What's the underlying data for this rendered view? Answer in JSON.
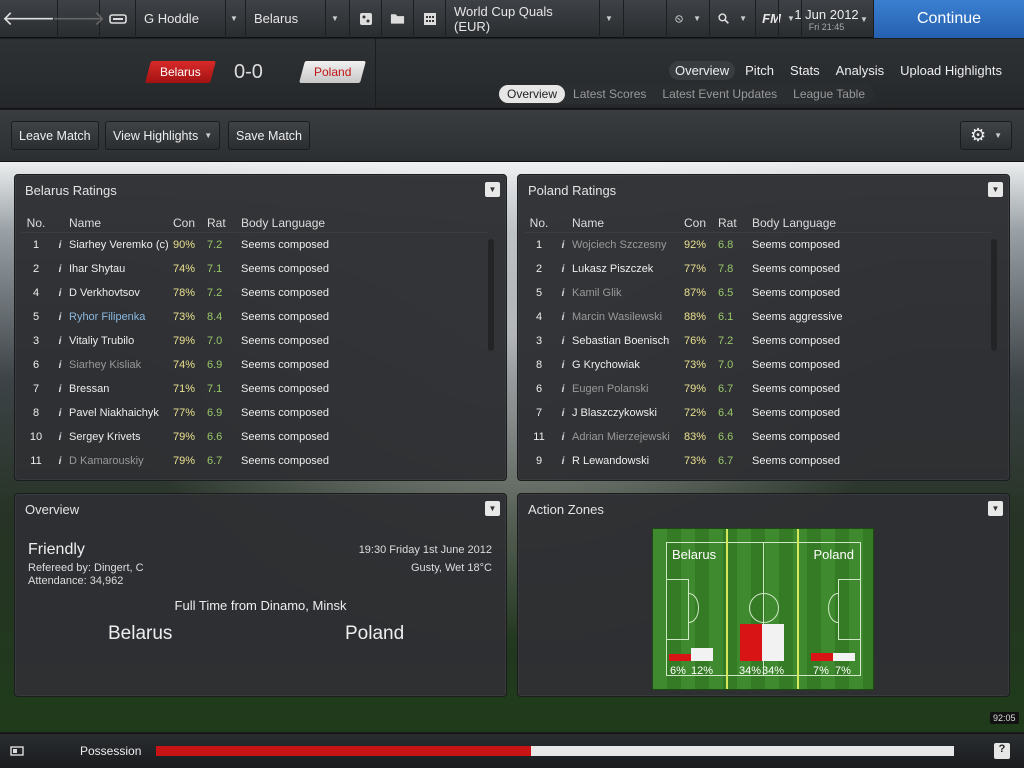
{
  "topbar": {
    "back": "🡐",
    "forward": "🡒",
    "manager": "G Hoddle",
    "team": "Belarus",
    "competition": "World Cup Quals (EUR)",
    "fm_logo": "FM",
    "date": "1 Jun 2012",
    "time": "Fri 21:45",
    "continue": "Continue"
  },
  "header": {
    "home": "Belarus",
    "away": "Poland",
    "score": "0-0",
    "tabs": [
      "Overview",
      "Pitch",
      "Stats",
      "Analysis",
      "Upload Highlights"
    ],
    "subtabs": [
      "Overview",
      "Latest Scores",
      "Latest Event Updates",
      "League Table"
    ]
  },
  "actions": {
    "leave": "Leave Match",
    "highlights": "View Highlights",
    "save": "Save Match"
  },
  "ratings_headers": {
    "no": "No.",
    "name": "Name",
    "con": "Con",
    "rat": "Rat",
    "body": "Body Language"
  },
  "belarus": {
    "title": "Belarus Ratings",
    "rows": [
      {
        "no": "1",
        "name": "Siarhey Veremko (c)",
        "con": "90%",
        "rat": "7.2",
        "body": "Seems composed",
        "style": ""
      },
      {
        "no": "2",
        "name": "Ihar Shytau",
        "con": "74%",
        "rat": "7.1",
        "body": "Seems composed",
        "style": ""
      },
      {
        "no": "4",
        "name": "D Verkhovtsov",
        "con": "78%",
        "rat": "7.2",
        "body": "Seems composed",
        "style": ""
      },
      {
        "no": "5",
        "name": "Ryhor Filipenka",
        "con": "73%",
        "rat": "8.4",
        "body": "Seems composed",
        "style": "blue"
      },
      {
        "no": "3",
        "name": "Vitaliy Trubilo",
        "con": "79%",
        "rat": "7.0",
        "body": "Seems composed",
        "style": ""
      },
      {
        "no": "6",
        "name": "Siarhey Kisliak",
        "con": "74%",
        "rat": "6.9",
        "body": "Seems composed",
        "style": "muted"
      },
      {
        "no": "7",
        "name": "Bressan",
        "con": "71%",
        "rat": "7.1",
        "body": "Seems composed",
        "style": ""
      },
      {
        "no": "8",
        "name": "Pavel Niakhaichyk",
        "con": "77%",
        "rat": "6.9",
        "body": "Seems composed",
        "style": ""
      },
      {
        "no": "10",
        "name": "Sergey Krivets",
        "con": "79%",
        "rat": "6.6",
        "body": "Seems composed",
        "style": ""
      },
      {
        "no": "11",
        "name": "D Kamarouskiy",
        "con": "79%",
        "rat": "6.7",
        "body": "Seems composed",
        "style": "muted"
      }
    ]
  },
  "poland": {
    "title": "Poland Ratings",
    "rows": [
      {
        "no": "1",
        "name": "Wojciech Szczesny",
        "con": "92%",
        "rat": "6.8",
        "body": "Seems composed",
        "style": "muted"
      },
      {
        "no": "2",
        "name": "Lukasz Piszczek",
        "con": "77%",
        "rat": "7.8",
        "body": "Seems composed",
        "style": ""
      },
      {
        "no": "5",
        "name": "Kamil Glik",
        "con": "87%",
        "rat": "6.5",
        "body": "Seems composed",
        "style": "muted"
      },
      {
        "no": "4",
        "name": "Marcin Wasilewski",
        "con": "88%",
        "rat": "6.1",
        "body": "Seems aggressive",
        "style": "muted"
      },
      {
        "no": "3",
        "name": "Sebastian Boenisch",
        "con": "76%",
        "rat": "7.2",
        "body": "Seems composed",
        "style": ""
      },
      {
        "no": "8",
        "name": "G Krychowiak",
        "con": "73%",
        "rat": "7.0",
        "body": "Seems composed",
        "style": ""
      },
      {
        "no": "6",
        "name": "Eugen Polanski",
        "con": "79%",
        "rat": "6.7",
        "body": "Seems composed",
        "style": "muted"
      },
      {
        "no": "7",
        "name": "J Blaszczykowski",
        "con": "72%",
        "rat": "6.4",
        "body": "Seems composed",
        "style": ""
      },
      {
        "no": "11",
        "name": "Adrian Mierzejewski",
        "con": "83%",
        "rat": "6.6",
        "body": "Seems composed",
        "style": "muted"
      },
      {
        "no": "9",
        "name": "R Lewandowski",
        "con": "73%",
        "rat": "6.7",
        "body": "Seems composed",
        "style": ""
      }
    ]
  },
  "overview": {
    "title": "Overview",
    "match_type": "Friendly",
    "referee": "Refereed by: Dingert, C",
    "attendance": "Attendance: 34,962",
    "kickoff": "19:30 Friday 1st June 2012",
    "weather": "Gusty, Wet 18°C",
    "status": "Full Time from Dinamo, Minsk",
    "home": "Belarus",
    "away": "Poland"
  },
  "zones": {
    "title": "Action Zones",
    "home": "Belarus",
    "away": "Poland",
    "left": {
      "red": "6%",
      "white": "12%",
      "red_v": 6,
      "white_v": 12
    },
    "mid": {
      "red": "34%",
      "white": "34%",
      "red_v": 34,
      "white_v": 34
    },
    "right": {
      "red": "7%",
      "white": "7%",
      "red_v": 7,
      "white_v": 7
    }
  },
  "bottom": {
    "possession_label": "Possession",
    "home_possession": 47,
    "clock": "92:05",
    "help": "?"
  }
}
